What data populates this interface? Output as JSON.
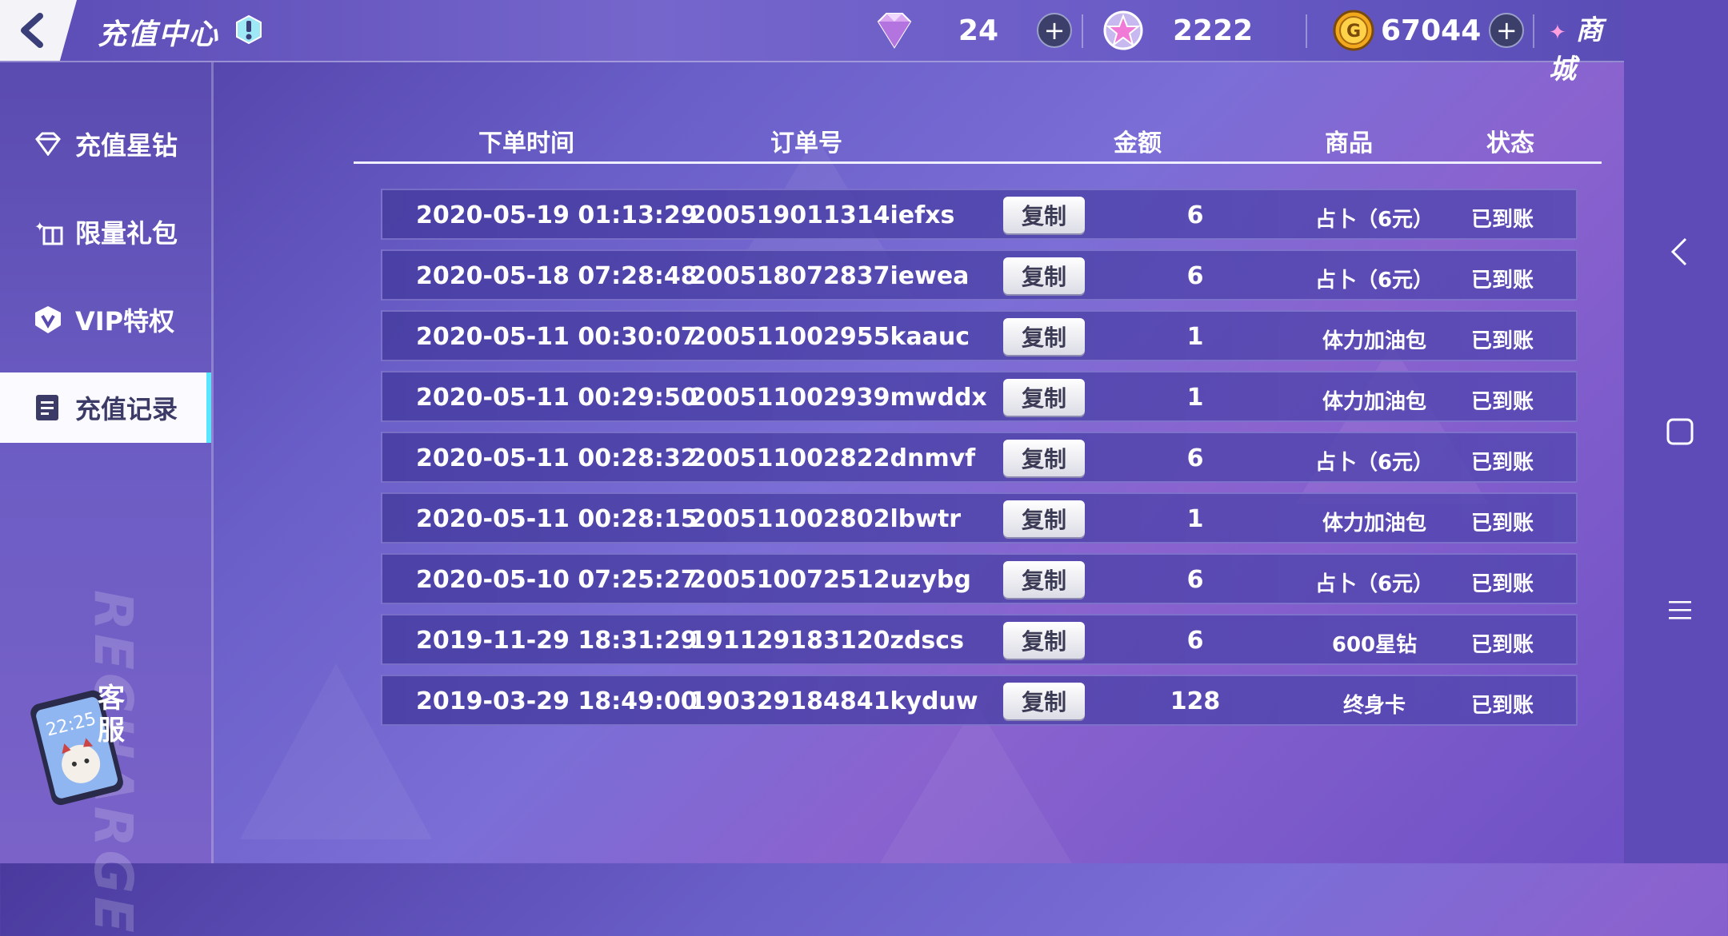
{
  "header": {
    "title": "充值中心",
    "currencies": [
      {
        "name": "diamond",
        "icon": "diamond-icon",
        "value": "24"
      },
      {
        "name": "star",
        "icon": "star-icon",
        "value": "2222"
      },
      {
        "name": "gold",
        "icon": "gold-coin-icon",
        "value": "67044"
      }
    ],
    "shop_label": "商城"
  },
  "sidebar": {
    "items": [
      {
        "label": "充值星钻",
        "icon": "diamond-icon",
        "active": false
      },
      {
        "label": "限量礼包",
        "icon": "gift-icon",
        "active": false
      },
      {
        "label": "VIP特权",
        "icon": "vip-shield-icon",
        "active": false
      },
      {
        "label": "充值记录",
        "icon": "record-icon",
        "active": true
      }
    ],
    "watermark": "RECHARGE",
    "customer_service": "客服"
  },
  "table": {
    "headers": [
      "下单时间",
      "订单号",
      "金额",
      "商品",
      "状态"
    ],
    "copy_label": "复制",
    "rows": [
      {
        "time": "2020-05-19 01:13:29",
        "order": "200519011314iefxs",
        "amount": "6",
        "product": "占卜（6元）",
        "status": "已到账"
      },
      {
        "time": "2020-05-18 07:28:48",
        "order": "200518072837iewea",
        "amount": "6",
        "product": "占卜（6元）",
        "status": "已到账"
      },
      {
        "time": "2020-05-11 00:30:07",
        "order": "200511002955kaauc",
        "amount": "1",
        "product": "体力加油包",
        "status": "已到账"
      },
      {
        "time": "2020-05-11 00:29:50",
        "order": "200511002939mwddx",
        "amount": "1",
        "product": "体力加油包",
        "status": "已到账"
      },
      {
        "time": "2020-05-11 00:28:32",
        "order": "200511002822dnmvf",
        "amount": "6",
        "product": "占卜（6元）",
        "status": "已到账"
      },
      {
        "time": "2020-05-11 00:28:15",
        "order": "200511002802lbwtr",
        "amount": "1",
        "product": "体力加油包",
        "status": "已到账"
      },
      {
        "time": "2020-05-10 07:25:27",
        "order": "200510072512uzybg",
        "amount": "6",
        "product": "占卜（6元）",
        "status": "已到账"
      },
      {
        "time": "2019-11-29 18:31:29",
        "order": "191129183120zdscs",
        "amount": "6",
        "product": "600星钻",
        "status": "已到账"
      },
      {
        "time": "2019-03-29 18:49:00",
        "order": "190329184841kyduw",
        "amount": "128",
        "product": "终身卡",
        "status": "已到账"
      }
    ]
  },
  "navbar": {
    "icons": [
      "nav-back-icon",
      "nav-home-icon",
      "nav-menu-icon"
    ]
  }
}
